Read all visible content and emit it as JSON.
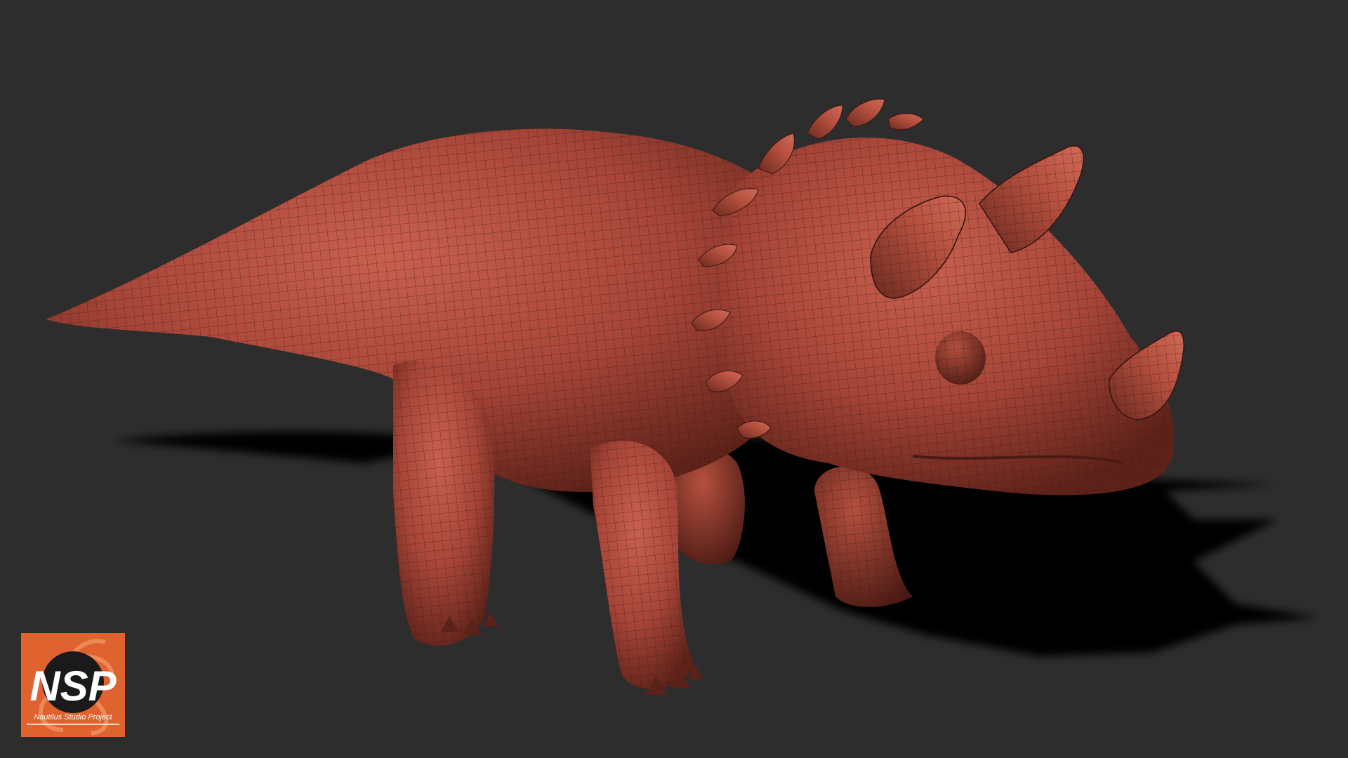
{
  "scene": {
    "subject": "triceratops-wireframe-sculpt",
    "background_color": "#2d2d2d",
    "body_color": "#a8473a",
    "shadow_color": "#050505"
  },
  "logo": {
    "monogram": "NSP",
    "caption": "Nautilus Studio Project",
    "badge_color": "#e0622f"
  }
}
